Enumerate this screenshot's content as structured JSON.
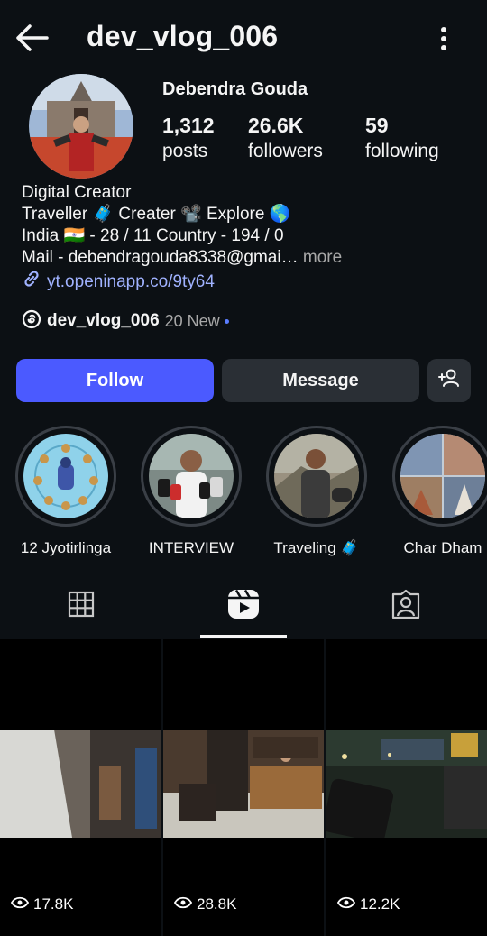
{
  "header": {
    "username": "dev_vlog_006"
  },
  "profile": {
    "full_name": "Debendra Gouda",
    "stats": [
      {
        "value": "1,312",
        "label": "posts"
      },
      {
        "value": "26.6K",
        "label": "followers"
      },
      {
        "value": "59",
        "label": "following"
      }
    ],
    "bio": [
      "Digital Creator",
      "Traveller 🧳 Creater 📽️ Explore 🌎",
      "India 🇮🇳 - 28 / 11   Country - 194 / 0",
      "Mail - debendragouda8338@gmai…"
    ],
    "more_label": " more",
    "link": "yt.openinapp.co/9ty64",
    "threads": {
      "name": "dev_vlog_006",
      "new_label": "20 New"
    }
  },
  "actions": {
    "follow": "Follow",
    "message": "Message"
  },
  "highlights": [
    {
      "label": "12 Jyotirlinga"
    },
    {
      "label": "INTERVIEW"
    },
    {
      "label": "Traveling 🧳"
    },
    {
      "label": "Char Dham"
    }
  ],
  "reels": [
    {
      "views": "17.8K"
    },
    {
      "views": "28.8K"
    },
    {
      "views": "12.2K"
    }
  ],
  "colors": {
    "accent": "#4b5aff",
    "link": "#a0b2ff",
    "background": "#0c1014"
  }
}
